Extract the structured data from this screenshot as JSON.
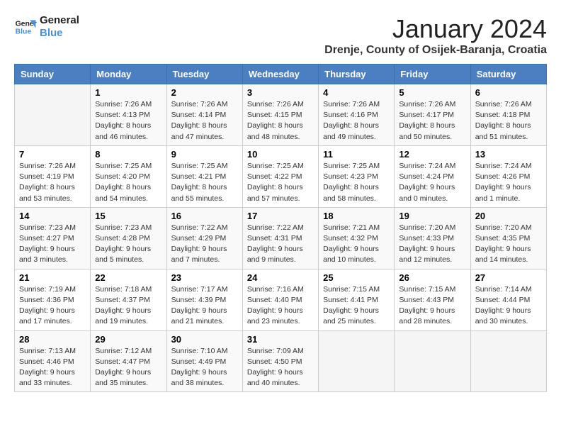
{
  "header": {
    "logo_line1": "General",
    "logo_line2": "Blue",
    "month": "January 2024",
    "location": "Drenje, County of Osijek-Baranja, Croatia"
  },
  "weekdays": [
    "Sunday",
    "Monday",
    "Tuesday",
    "Wednesday",
    "Thursday",
    "Friday",
    "Saturday"
  ],
  "weeks": [
    [
      {
        "day": "",
        "info": ""
      },
      {
        "day": "1",
        "info": "Sunrise: 7:26 AM\nSunset: 4:13 PM\nDaylight: 8 hours\nand 46 minutes."
      },
      {
        "day": "2",
        "info": "Sunrise: 7:26 AM\nSunset: 4:14 PM\nDaylight: 8 hours\nand 47 minutes."
      },
      {
        "day": "3",
        "info": "Sunrise: 7:26 AM\nSunset: 4:15 PM\nDaylight: 8 hours\nand 48 minutes."
      },
      {
        "day": "4",
        "info": "Sunrise: 7:26 AM\nSunset: 4:16 PM\nDaylight: 8 hours\nand 49 minutes."
      },
      {
        "day": "5",
        "info": "Sunrise: 7:26 AM\nSunset: 4:17 PM\nDaylight: 8 hours\nand 50 minutes."
      },
      {
        "day": "6",
        "info": "Sunrise: 7:26 AM\nSunset: 4:18 PM\nDaylight: 8 hours\nand 51 minutes."
      }
    ],
    [
      {
        "day": "7",
        "info": "Sunrise: 7:26 AM\nSunset: 4:19 PM\nDaylight: 8 hours\nand 53 minutes."
      },
      {
        "day": "8",
        "info": "Sunrise: 7:25 AM\nSunset: 4:20 PM\nDaylight: 8 hours\nand 54 minutes."
      },
      {
        "day": "9",
        "info": "Sunrise: 7:25 AM\nSunset: 4:21 PM\nDaylight: 8 hours\nand 55 minutes."
      },
      {
        "day": "10",
        "info": "Sunrise: 7:25 AM\nSunset: 4:22 PM\nDaylight: 8 hours\nand 57 minutes."
      },
      {
        "day": "11",
        "info": "Sunrise: 7:25 AM\nSunset: 4:23 PM\nDaylight: 8 hours\nand 58 minutes."
      },
      {
        "day": "12",
        "info": "Sunrise: 7:24 AM\nSunset: 4:24 PM\nDaylight: 9 hours\nand 0 minutes."
      },
      {
        "day": "13",
        "info": "Sunrise: 7:24 AM\nSunset: 4:26 PM\nDaylight: 9 hours\nand 1 minute."
      }
    ],
    [
      {
        "day": "14",
        "info": "Sunrise: 7:23 AM\nSunset: 4:27 PM\nDaylight: 9 hours\nand 3 minutes."
      },
      {
        "day": "15",
        "info": "Sunrise: 7:23 AM\nSunset: 4:28 PM\nDaylight: 9 hours\nand 5 minutes."
      },
      {
        "day": "16",
        "info": "Sunrise: 7:22 AM\nSunset: 4:29 PM\nDaylight: 9 hours\nand 7 minutes."
      },
      {
        "day": "17",
        "info": "Sunrise: 7:22 AM\nSunset: 4:31 PM\nDaylight: 9 hours\nand 9 minutes."
      },
      {
        "day": "18",
        "info": "Sunrise: 7:21 AM\nSunset: 4:32 PM\nDaylight: 9 hours\nand 10 minutes."
      },
      {
        "day": "19",
        "info": "Sunrise: 7:20 AM\nSunset: 4:33 PM\nDaylight: 9 hours\nand 12 minutes."
      },
      {
        "day": "20",
        "info": "Sunrise: 7:20 AM\nSunset: 4:35 PM\nDaylight: 9 hours\nand 14 minutes."
      }
    ],
    [
      {
        "day": "21",
        "info": "Sunrise: 7:19 AM\nSunset: 4:36 PM\nDaylight: 9 hours\nand 17 minutes."
      },
      {
        "day": "22",
        "info": "Sunrise: 7:18 AM\nSunset: 4:37 PM\nDaylight: 9 hours\nand 19 minutes."
      },
      {
        "day": "23",
        "info": "Sunrise: 7:17 AM\nSunset: 4:39 PM\nDaylight: 9 hours\nand 21 minutes."
      },
      {
        "day": "24",
        "info": "Sunrise: 7:16 AM\nSunset: 4:40 PM\nDaylight: 9 hours\nand 23 minutes."
      },
      {
        "day": "25",
        "info": "Sunrise: 7:15 AM\nSunset: 4:41 PM\nDaylight: 9 hours\nand 25 minutes."
      },
      {
        "day": "26",
        "info": "Sunrise: 7:15 AM\nSunset: 4:43 PM\nDaylight: 9 hours\nand 28 minutes."
      },
      {
        "day": "27",
        "info": "Sunrise: 7:14 AM\nSunset: 4:44 PM\nDaylight: 9 hours\nand 30 minutes."
      }
    ],
    [
      {
        "day": "28",
        "info": "Sunrise: 7:13 AM\nSunset: 4:46 PM\nDaylight: 9 hours\nand 33 minutes."
      },
      {
        "day": "29",
        "info": "Sunrise: 7:12 AM\nSunset: 4:47 PM\nDaylight: 9 hours\nand 35 minutes."
      },
      {
        "day": "30",
        "info": "Sunrise: 7:10 AM\nSunset: 4:49 PM\nDaylight: 9 hours\nand 38 minutes."
      },
      {
        "day": "31",
        "info": "Sunrise: 7:09 AM\nSunset: 4:50 PM\nDaylight: 9 hours\nand 40 minutes."
      },
      {
        "day": "",
        "info": ""
      },
      {
        "day": "",
        "info": ""
      },
      {
        "day": "",
        "info": ""
      }
    ]
  ]
}
